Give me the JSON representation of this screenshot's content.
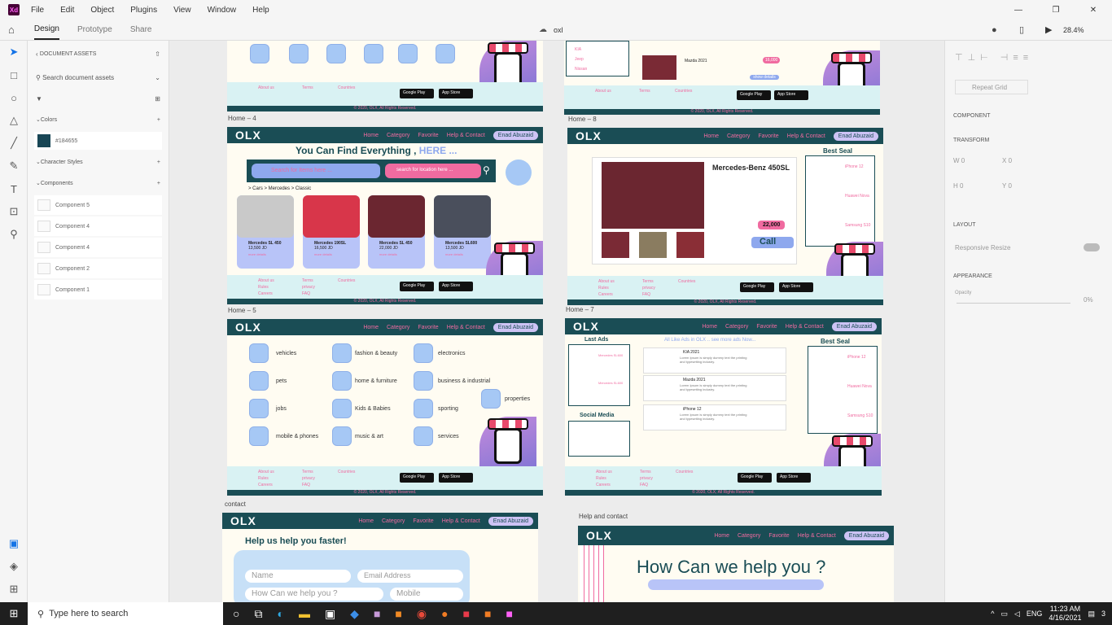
{
  "app": {
    "menu": [
      "File",
      "Edit",
      "Object",
      "Plugins",
      "View",
      "Window",
      "Help"
    ],
    "doc_title": "oxl",
    "zoom": "28.4%"
  },
  "modes": [
    "Design",
    "Prototype",
    "Share"
  ],
  "assets": {
    "header": "DOCUMENT ASSETS",
    "search_placeholder": "Search document assets",
    "colors_label": "Colors",
    "color_hex": "#184655",
    "char_styles_label": "Character Styles",
    "components_label": "Components",
    "components": [
      "Component 5",
      "Component 4",
      "Component 4",
      "Component 2",
      "Component 1"
    ]
  },
  "props": {
    "repeat_grid": "Repeat Grid",
    "component": "COMPONENT",
    "transform": "TRANSFORM",
    "w_label": "W",
    "w_val": "0",
    "x_label": "X",
    "x_val": "0",
    "h_label": "H",
    "h_val": "0",
    "y_label": "Y",
    "y_val": "0",
    "layout": "LAYOUT",
    "responsive": "Responsive Resize",
    "appearance": "APPEARANCE",
    "opacity_label": "Opacity",
    "opacity_val": "0%"
  },
  "taskbar": {
    "search": "Type here to search",
    "lang": "ENG",
    "time": "11:23 AM",
    "date": "4/16/2021",
    "notif": "3"
  },
  "nav": {
    "logo": "OLX",
    "links": [
      "Home",
      "Category",
      "Favorite",
      "Help & Contact"
    ],
    "user": "Enad Abuzaid"
  },
  "footer": {
    "col1": [
      "About us",
      "Rules",
      "Careers"
    ],
    "col2": [
      "Terms",
      "privacy",
      "FAQ"
    ],
    "col3": "Countries",
    "google": "Google Play",
    "apple": "App Store",
    "copyright": "© 2020, OLX, All Rights Reserved."
  },
  "labels": {
    "home4": "Home – 4",
    "home8": "Home – 8",
    "home5": "Home – 5",
    "home7": "Home – 7",
    "contact": "contact",
    "help": "Help and contact"
  },
  "home5": {
    "headline": "You Can Find Everything ,",
    "here": "HERE ...",
    "search1": "Search for Items here ...",
    "search2": "search for location here ...",
    "crumb": "> Cars > Mercedes > Classic",
    "cards": [
      {
        "name": "Mercedes SL 450",
        "price": "13,500 JD"
      },
      {
        "name": "Mercedes 190SL",
        "price": "16,500 JD"
      },
      {
        "name": "Mercedes SL 450",
        "price": "22,000 JD"
      },
      {
        "name": "Mercedes SL600",
        "price": "13,500 JD"
      }
    ],
    "more": "more details"
  },
  "home7": {
    "title": "Mercedes-Benz 450SL",
    "price": "22,000",
    "call": "Call",
    "best": "Best Seal",
    "products": [
      "iPhone 12",
      "Huawei Nova",
      "Samsung S10"
    ],
    "show": "show details"
  },
  "home8": {
    "brands": [
      "KIA",
      "Jeep",
      "Nissan"
    ],
    "model": "Mazda 2021",
    "price": "16,000",
    "show": "show details"
  },
  "home_cats": {
    "items": [
      "vehicles",
      "fashion & beauty",
      "electronics",
      "pets",
      "home & furniture",
      "business & industrial",
      "properties",
      "jobs",
      "Kids & Babies",
      "sporting",
      "mobile & phones",
      "music & art",
      "services"
    ]
  },
  "ads": {
    "last": "Last Ads",
    "all": "All Like Ads in OLX .. see more ads Now...",
    "items": [
      "KIA 2021",
      "Mazda 2021",
      "iPhone 12"
    ],
    "desc": "Lorem Ipsum is simply dummy text the printing and typesetting industry.",
    "social": "Social Media",
    "mini": [
      "Mercedes SL600",
      "Mercedes SL600"
    ],
    "best": "Best Seal",
    "products": [
      "iPhone 12",
      "Huawei Nova",
      "Samsung S10"
    ],
    "show": "show details"
  },
  "contact": {
    "heading": "Help us help you faster!",
    "name": "Name",
    "email": "Email Address",
    "help": "How Can we help you ?",
    "mobile": "Mobile"
  },
  "helpc": {
    "heading": "How Can we help you ?"
  }
}
